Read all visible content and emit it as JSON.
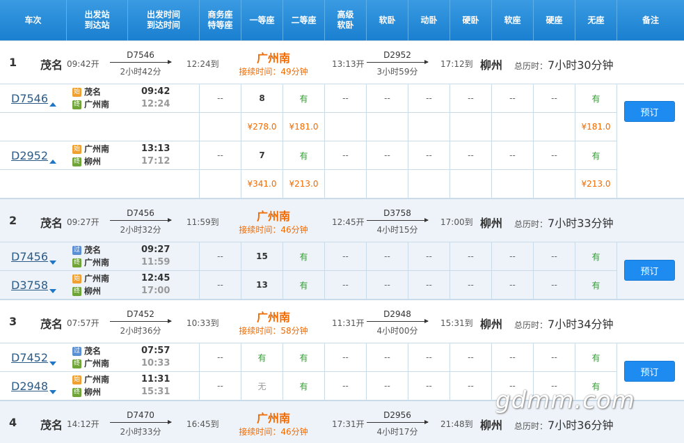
{
  "header": [
    "车次",
    "出发站\n到达站",
    "出发时间\n到达时间",
    "商务座\n特等座",
    "一等座",
    "二等座",
    "高级\n软卧",
    "软卧",
    "动卧",
    "硬卧",
    "软座",
    "硬座",
    "无座",
    "备注"
  ],
  "book_label": "预订",
  "total_prefix": "总历时：",
  "wait_prefix": "接续时间：",
  "dash": "--",
  "results": [
    {
      "index": "1",
      "origin": "茂名",
      "dep": "09:42开",
      "leg1_train": "D7546",
      "leg1_dur": "2小时42分",
      "leg1_arr": "12:24到",
      "hub": "广州南",
      "wait": "49分钟",
      "leg2_dep": "13:13开",
      "leg2_train": "D2952",
      "leg2_dur": "3小时59分",
      "leg2_arr": "17:12到",
      "dest": "柳州",
      "total": "7小时30分钟",
      "trains": [
        {
          "no": "D7546",
          "from": "茂名",
          "from_badge": "始",
          "to": "广州南",
          "to_badge": "终",
          "dep": "09:42",
          "arr": "12:24",
          "first": "8",
          "second": "有",
          "none": "有",
          "first_price": "¥278.0",
          "second_price": "¥181.0",
          "none_price": "¥181.0"
        },
        {
          "no": "D2952",
          "from": "广州南",
          "from_badge": "始",
          "to": "柳州",
          "to_badge": "终",
          "dep": "13:13",
          "arr": "17:12",
          "first": "7",
          "second": "有",
          "none": "有",
          "first_price": "¥341.0",
          "second_price": "¥213.0",
          "none_price": "¥213.0"
        }
      ]
    },
    {
      "index": "2",
      "origin": "茂名",
      "dep": "09:27开",
      "leg1_train": "D7456",
      "leg1_dur": "2小时32分",
      "leg1_arr": "11:59到",
      "hub": "广州南",
      "wait": "46分钟",
      "leg2_dep": "12:45开",
      "leg2_train": "D3758",
      "leg2_dur": "4小时15分",
      "leg2_arr": "17:00到",
      "dest": "柳州",
      "total": "7小时33分钟",
      "trains": [
        {
          "no": "D7456",
          "from": "茂名",
          "from_badge": "过",
          "to": "广州南",
          "to_badge": "终",
          "dep": "09:27",
          "arr": "11:59",
          "first": "15",
          "second": "有",
          "none": "有"
        },
        {
          "no": "D3758",
          "from": "广州南",
          "from_badge": "始",
          "to": "柳州",
          "to_badge": "终",
          "dep": "12:45",
          "arr": "17:00",
          "first": "13",
          "second": "有",
          "none": "有"
        }
      ]
    },
    {
      "index": "3",
      "origin": "茂名",
      "dep": "07:57开",
      "leg1_train": "D7452",
      "leg1_dur": "2小时36分",
      "leg1_arr": "10:33到",
      "hub": "广州南",
      "wait": "58分钟",
      "leg2_dep": "11:31开",
      "leg2_train": "D2948",
      "leg2_dur": "4小时00分",
      "leg2_arr": "15:31到",
      "dest": "柳州",
      "total": "7小时34分钟",
      "trains": [
        {
          "no": "D7452",
          "from": "茂名",
          "from_badge": "过",
          "to": "广州南",
          "to_badge": "终",
          "dep": "07:57",
          "arr": "10:33",
          "first": "有",
          "second": "有",
          "none": "有"
        },
        {
          "no": "D2948",
          "from": "广州南",
          "from_badge": "始",
          "to": "柳州",
          "to_badge": "终",
          "dep": "11:31",
          "arr": "15:31",
          "first": "无",
          "second": "有",
          "none": "有"
        }
      ]
    },
    {
      "index": "4",
      "origin": "茂名",
      "dep": "14:12开",
      "leg1_train": "D7470",
      "leg1_dur": "2小时33分",
      "leg1_arr": "16:45到",
      "hub": "广州南",
      "wait": "46分钟",
      "leg2_dep": "17:31开",
      "leg2_train": "D2956",
      "leg2_dur": "4小时17分",
      "leg2_arr": "21:48到",
      "dest": "柳州",
      "total": "7小时36分钟"
    }
  ],
  "watermark": "gdmm.com"
}
